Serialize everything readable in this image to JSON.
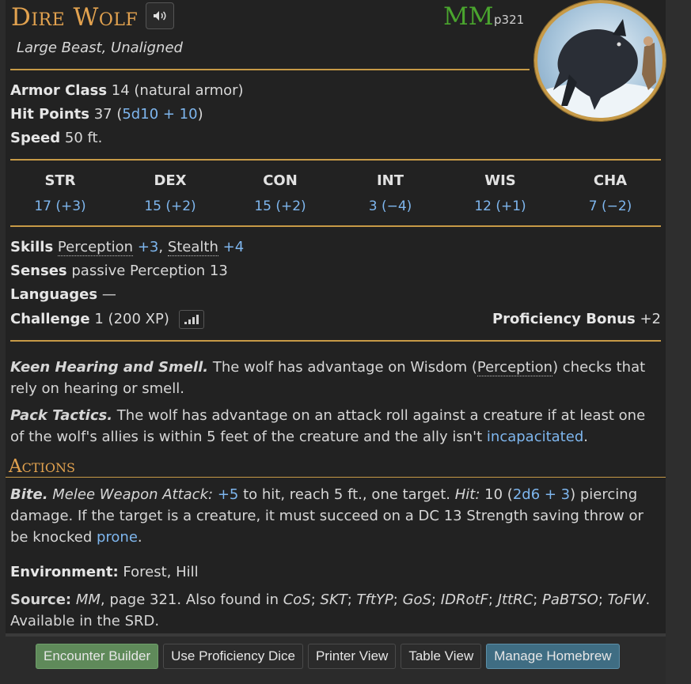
{
  "creature": {
    "name": "Dire Wolf",
    "source_abbr": "MM",
    "source_page": "p321",
    "subtitle": "Large Beast, Unaligned"
  },
  "stats": {
    "ac_label": "Armor Class",
    "ac_value": "14 (natural armor)",
    "hp_label": "Hit Points",
    "hp_value": "37 (",
    "hp_dice": "5d10 + 10",
    "hp_close": ")",
    "speed_label": "Speed",
    "speed_value": "50 ft."
  },
  "abilities": [
    {
      "name": "STR",
      "value": "17 (+3)"
    },
    {
      "name": "DEX",
      "value": "15 (+2)"
    },
    {
      "name": "CON",
      "value": "15 (+2)"
    },
    {
      "name": "INT",
      "value": "3 (−4)"
    },
    {
      "name": "WIS",
      "value": "12 (+1)"
    },
    {
      "name": "CHA",
      "value": "7 (−2)"
    }
  ],
  "details": {
    "skills_label": "Skills",
    "skill1": "Perception",
    "skill1_bonus": "+3",
    "skill2": "Stealth",
    "skill2_bonus": "+4",
    "senses_label": "Senses",
    "senses_value": "passive Perception 13",
    "languages_label": "Languages",
    "languages_value": "—",
    "challenge_label": "Challenge",
    "challenge_value": "1 (200 XP)",
    "prof_label": "Proficiency Bonus",
    "prof_value": "+2"
  },
  "traits": [
    {
      "name": "Keen Hearing and Smell.",
      "text_a": "The wolf has advantage on Wisdom (",
      "link": "Perception",
      "text_b": ") checks that rely on hearing or smell."
    },
    {
      "name": "Pack Tactics.",
      "text_a": "The wolf has advantage on an attack roll against a creature if at least one of the wolf's allies is within 5 feet of the creature and the ally isn't ",
      "link": "incapacitated",
      "text_b": "."
    }
  ],
  "actions": {
    "header": "Actions",
    "bite_name": "Bite.",
    "bite_type": "Melee Weapon Attack:",
    "bite_bonus": "+5",
    "bite_text1": "to hit, reach 5 ft., one target.",
    "bite_hit": "Hit:",
    "bite_dmg": "10 (",
    "bite_dice": "2d6 + 3",
    "bite_text2": ") piercing damage. If the target is a creature, it must succeed on a DC 13 Strength saving throw or be knocked ",
    "bite_link": "prone",
    "bite_end": "."
  },
  "footer": {
    "env_label": "Environment:",
    "env_value": "Forest, Hill",
    "source_label": "Source:",
    "source_book": "MM",
    "source_text": ", page 321. Also found in ",
    "books": [
      "CoS",
      "SKT",
      "TftYP",
      "GoS",
      "IDRotF",
      "JttRC",
      "PaBTSO",
      "ToFW"
    ],
    "srd": "Available in the SRD."
  },
  "buttons": {
    "encounter": "Encounter Builder",
    "prof_dice": "Use Proficiency Dice",
    "printer": "Printer View",
    "table": "Table View",
    "homebrew": "Manage Homebrew"
  },
  "colors": {
    "accent": "#c79a47",
    "title": "#e2a24f",
    "link": "#7eb6ee",
    "source": "#4aa52e"
  }
}
